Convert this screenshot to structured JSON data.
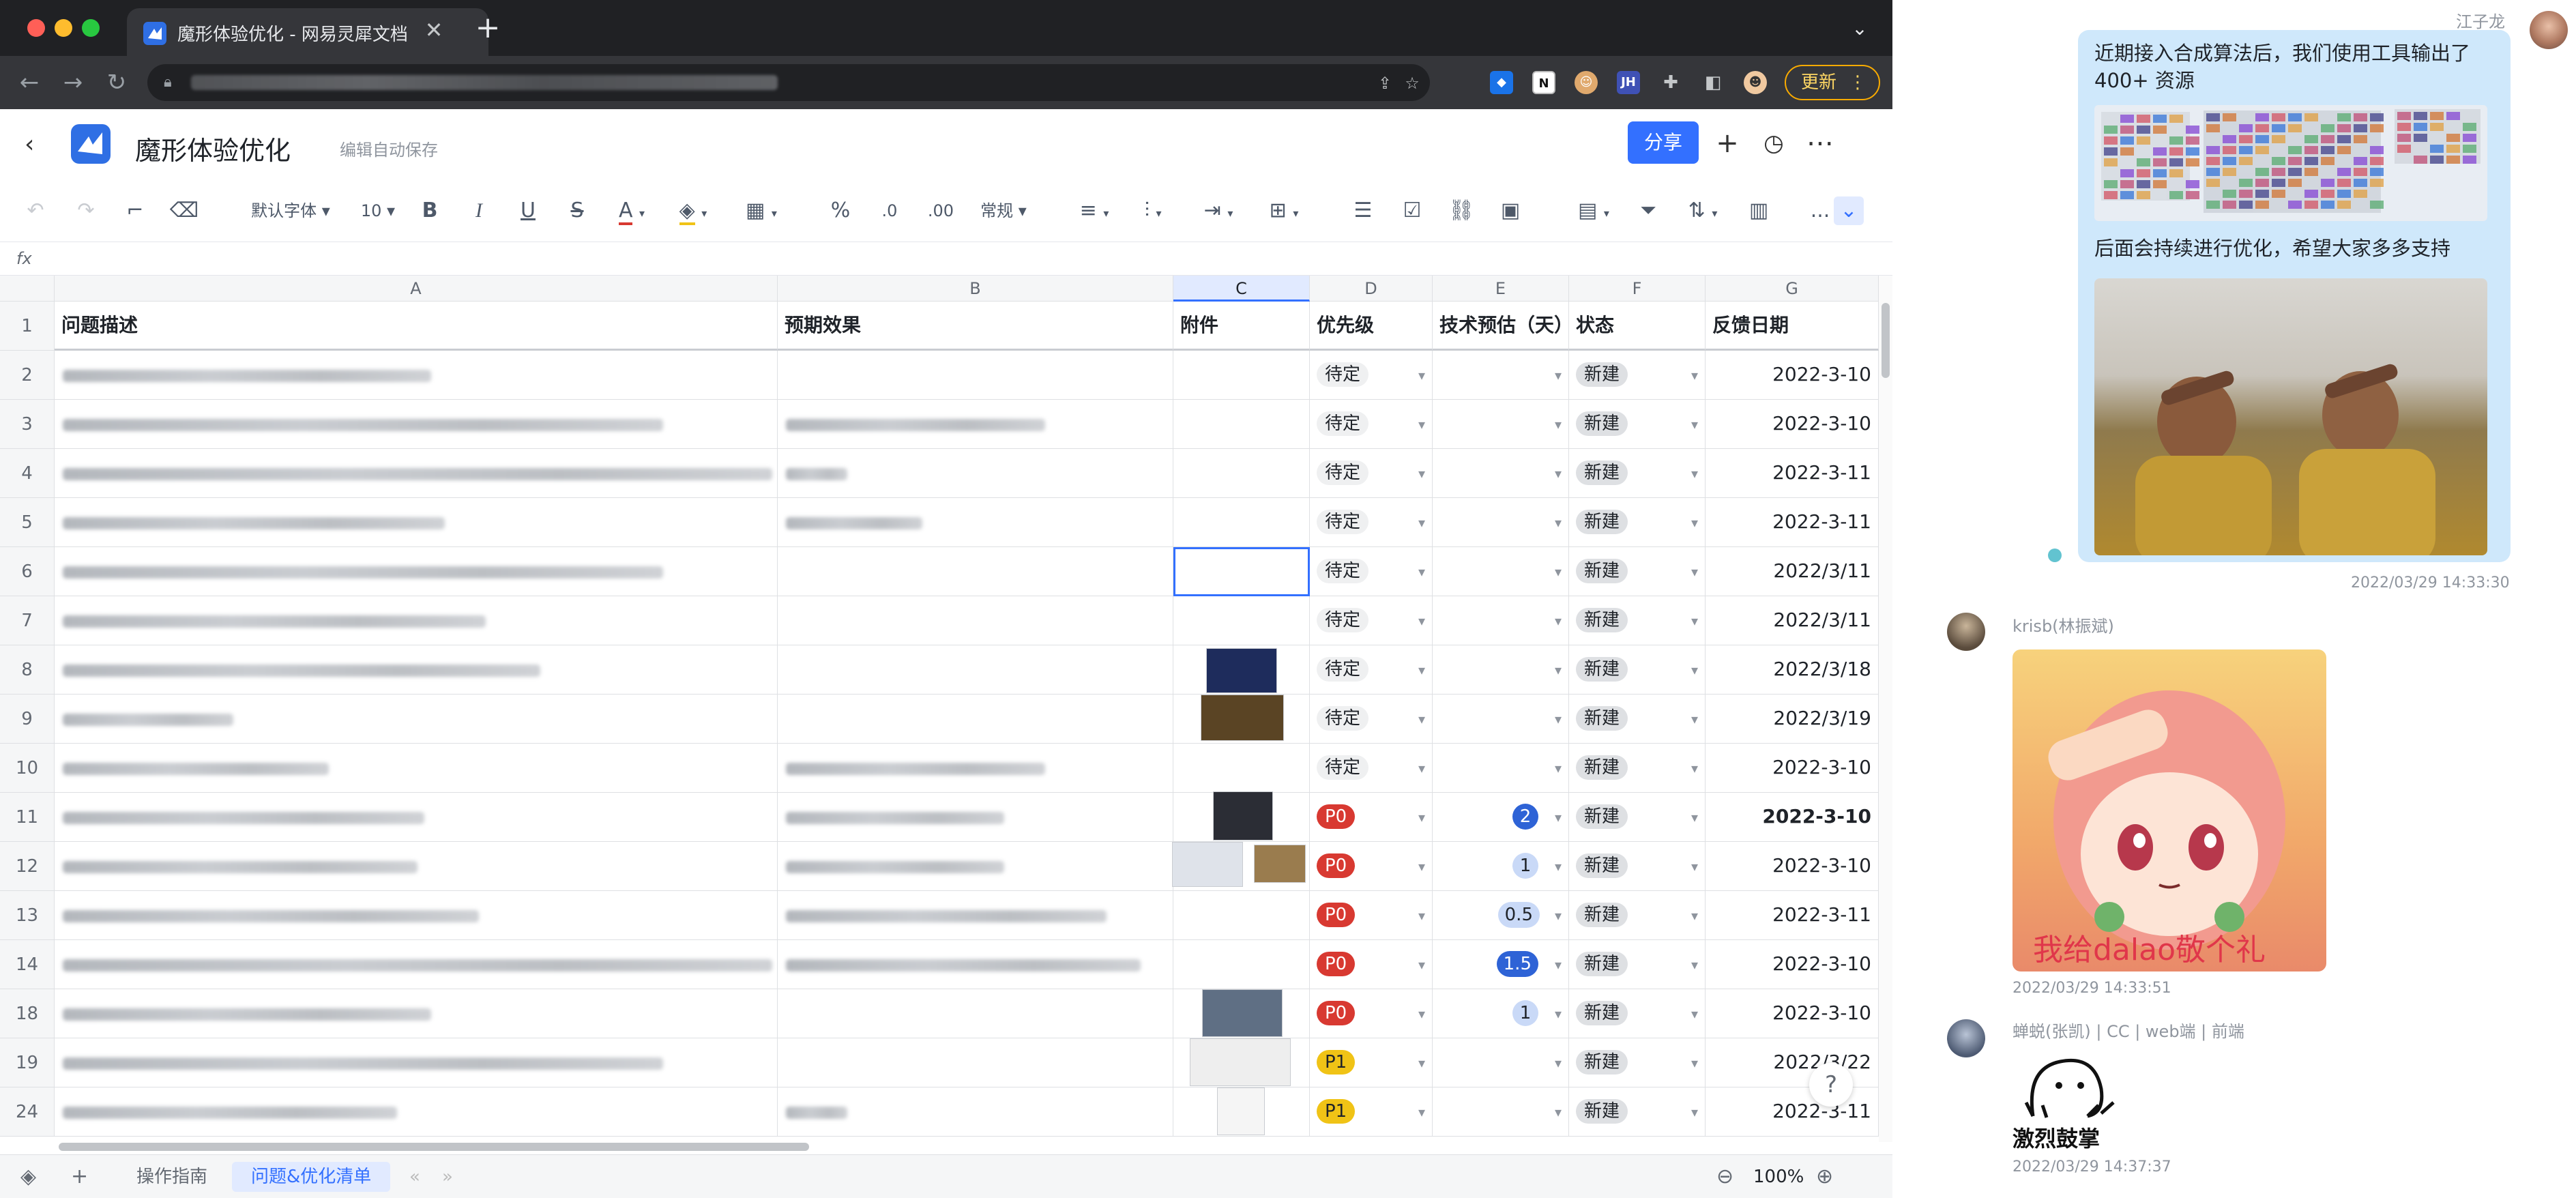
{
  "browser": {
    "tab_title": "魔形体验优化 - 网易灵犀文档",
    "update_label": "更新",
    "close_glyph": "✕",
    "newtab_glyph": "+"
  },
  "doc": {
    "title": "魔形体验优化",
    "autosave": "编辑自动保存",
    "share_label": "分享"
  },
  "toolbar": {
    "font_family": "默认字体",
    "font_size": "10",
    "number_format": "常规",
    "more": "..."
  },
  "formula": {
    "label": "fx"
  },
  "columns": [
    "A",
    "B",
    "C",
    "D",
    "E",
    "F",
    "G"
  ],
  "headers": {
    "a": "问题描述",
    "b": "预期效果",
    "c": "附件",
    "d": "优先级",
    "e": "技术预估（天）",
    "f": "状态",
    "g": "反馈日期"
  },
  "rows": [
    {
      "num": "2",
      "priority": "待定",
      "estimate": "",
      "status": "新建",
      "date": "2022-3-10"
    },
    {
      "num": "3",
      "priority": "待定",
      "estimate": "",
      "status": "新建",
      "date": "2022-3-10"
    },
    {
      "num": "4",
      "priority": "待定",
      "estimate": "",
      "status": "新建",
      "date": "2022-3-11"
    },
    {
      "num": "5",
      "priority": "待定",
      "estimate": "",
      "status": "新建",
      "date": "2022-3-11"
    },
    {
      "num": "6",
      "priority": "待定",
      "estimate": "",
      "status": "新建",
      "date": "2022/3/11"
    },
    {
      "num": "7",
      "priority": "待定",
      "estimate": "",
      "status": "新建",
      "date": "2022/3/11"
    },
    {
      "num": "8",
      "priority": "待定",
      "estimate": "",
      "status": "新建",
      "date": "2022/3/18"
    },
    {
      "num": "9",
      "priority": "待定",
      "estimate": "",
      "status": "新建",
      "date": "2022/3/19"
    },
    {
      "num": "10",
      "priority": "待定",
      "estimate": "",
      "status": "新建",
      "date": "2022-3-10"
    },
    {
      "num": "11",
      "priority": "P0",
      "estimate": "2",
      "status": "新建",
      "date": "2022-3-10"
    },
    {
      "num": "12",
      "priority": "P0",
      "estimate": "1",
      "status": "新建",
      "date": "2022-3-10"
    },
    {
      "num": "13",
      "priority": "P0",
      "estimate": "0.5",
      "status": "新建",
      "date": "2022-3-11"
    },
    {
      "num": "14",
      "priority": "P0",
      "estimate": "1.5",
      "status": "新建",
      "date": "2022-3-10"
    },
    {
      "num": "18",
      "priority": "P0",
      "estimate": "1",
      "status": "新建",
      "date": "2022-3-10"
    },
    {
      "num": "19",
      "priority": "P1",
      "estimate": "",
      "status": "新建",
      "date": "2022/3/22"
    },
    {
      "num": "24",
      "priority": "P1",
      "estimate": "",
      "status": "新建",
      "date": "2022-3-11"
    }
  ],
  "sheets": {
    "guide": "操作指南",
    "issues": "问题&优化清单"
  },
  "zoom": "100%",
  "help": "?",
  "chat": {
    "msg1": {
      "sender": "江子龙",
      "text1": "近期接入合成算法后，我们使用工具输出了400+ 资源",
      "text2": "后面会持续进行优化，希望大家多多支持",
      "time": "2022/03/29 14:33:30"
    },
    "msg2": {
      "sender": "krisb(林振斌)",
      "sticker_caption": "我给dalao敬个礼",
      "time": "2022/03/29 14:33:51"
    },
    "msg3": {
      "sender": "蝉蜕(张凯) | CC | web端 | 前端",
      "sticker_caption": "激烈鼓掌",
      "time": "2022/03/29 14:37:37"
    }
  },
  "colors": {
    "accent": "#3370ff",
    "p0": "#d83931",
    "p1": "#f0c316",
    "chat_bubble": "#cfe8fb"
  }
}
